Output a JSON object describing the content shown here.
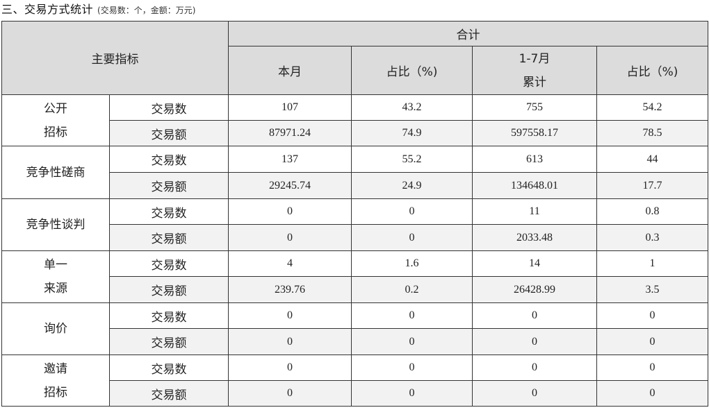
{
  "title": {
    "main": "三、交易方式统计",
    "note": "(交易数：个，金额：万元)"
  },
  "header": {
    "main_indicator": "主要指标",
    "total_group": "合计",
    "col_this_month": "本月",
    "col_pct_1": "占比（%)",
    "col_ytd_line1": "1-7月",
    "col_ytd_line2": "累计",
    "col_pct_2": "占比（%)"
  },
  "rows": [
    {
      "cat_line1": "公开",
      "cat_line2": "招标",
      "count": {
        "metric": "交易数",
        "month": "107",
        "pct1": "43.2",
        "ytd": "755",
        "pct2": "54.2"
      },
      "amount": {
        "metric": "交易额",
        "month": "87971.24",
        "pct1": "74.9",
        "ytd": "597558.17",
        "pct2": "78.5"
      }
    },
    {
      "cat_line1": "竞争性磋商",
      "cat_line2": "",
      "count": {
        "metric": "交易数",
        "month": "137",
        "pct1": "55.2",
        "ytd": "613",
        "pct2": "44"
      },
      "amount": {
        "metric": "交易额",
        "month": "29245.74",
        "pct1": "24.9",
        "ytd": "134648.01",
        "pct2": "17.7"
      }
    },
    {
      "cat_line1": "竞争性谈判",
      "cat_line2": "",
      "count": {
        "metric": "交易数",
        "month": "0",
        "pct1": "0",
        "ytd": "11",
        "pct2": "0.8"
      },
      "amount": {
        "metric": "交易额",
        "month": "0",
        "pct1": "0",
        "ytd": "2033.48",
        "pct2": "0.3"
      }
    },
    {
      "cat_line1": "单一",
      "cat_line2": "来源",
      "count": {
        "metric": "交易数",
        "month": "4",
        "pct1": "1.6",
        "ytd": "14",
        "pct2": "1"
      },
      "amount": {
        "metric": "交易额",
        "month": "239.76",
        "pct1": "0.2",
        "ytd": "26428.99",
        "pct2": "3.5"
      }
    },
    {
      "cat_line1": "询价",
      "cat_line2": "",
      "count": {
        "metric": "交易数",
        "month": "0",
        "pct1": "0",
        "ytd": "0",
        "pct2": "0"
      },
      "amount": {
        "metric": "交易额",
        "month": "0",
        "pct1": "0",
        "ytd": "0",
        "pct2": "0"
      }
    },
    {
      "cat_line1": "邀请",
      "cat_line2": "招标",
      "count": {
        "metric": "交易数",
        "month": "0",
        "pct1": "0",
        "ytd": "0",
        "pct2": "0"
      },
      "amount": {
        "metric": "交易额",
        "month": "0",
        "pct1": "0",
        "ytd": "0",
        "pct2": "0"
      }
    }
  ]
}
